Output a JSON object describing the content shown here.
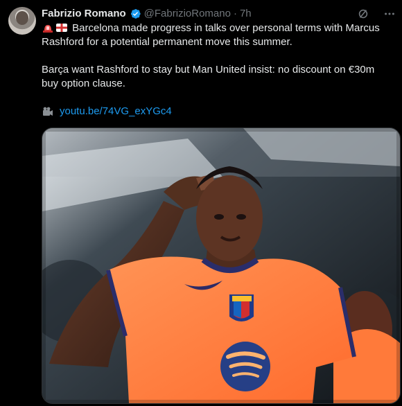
{
  "author": {
    "name": "Fabrizio Romano",
    "handle": "@FabrizioRomano",
    "separator": "·",
    "time": "7h"
  },
  "tweet": {
    "paragraph1": "Barcelona made progress in talks over personal terms with Marcus Rashford for a potential permanent move this summer.",
    "paragraph2": "Barça want Rashford to stay but Man United insist: no discount on €30m buy option clause.",
    "link_text": "youtu.be/74VG_exYGc4"
  },
  "icons": {
    "avatar": "avatar",
    "verified": "verified-badge-icon",
    "grok": "grok-icon",
    "more": "more-icon",
    "siren": "siren-emoji-icon",
    "flag": "england-flag-icon",
    "camera": "movie-camera-icon"
  },
  "colors": {
    "background": "#000000",
    "text": "#e7e9ea",
    "muted": "#71767b",
    "link": "#1d9bf0",
    "jersey": "#ff7a3a"
  }
}
